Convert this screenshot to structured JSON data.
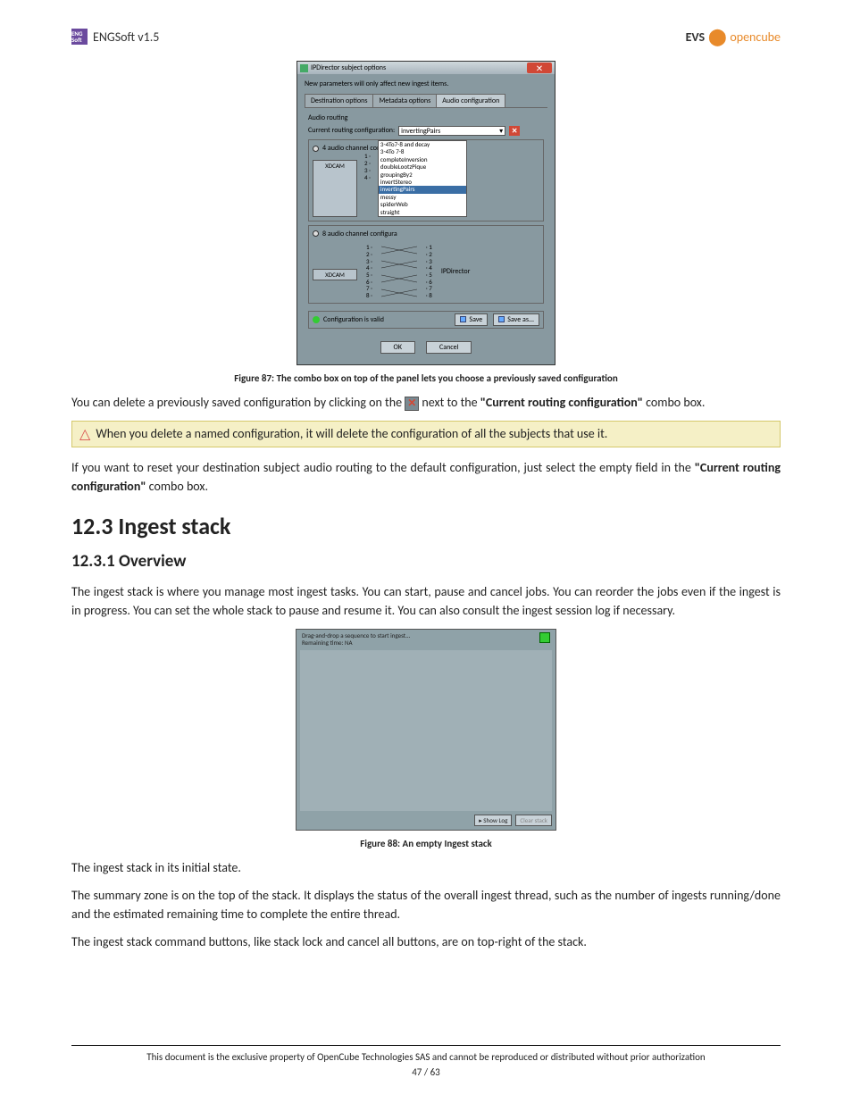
{
  "header": {
    "logo_text": "ENG Soft",
    "title": "ENGSoft v1.5",
    "right_brand1": "EVS",
    "right_brand2": "opencube"
  },
  "dialog87": {
    "title": "IPDirector subject options",
    "notice": "New parameters will only affect new ingest items.",
    "tabs": [
      "Destination options",
      "Metadata options",
      "Audio configuration"
    ],
    "panel_label": "Audio routing",
    "combo_label": "Current routing configuration:",
    "combo_value": "invertingPairs",
    "dropdown_items": [
      "3-4To7-8 and decay",
      "3-4To 7-8",
      "completeInversion",
      "doubleLootzPique",
      "groupingBy2",
      "invertStereo",
      "invertingPairs",
      "messy",
      "spiderWeb",
      "straight"
    ],
    "group4_label": "4 audio channel configura",
    "group8_label": "8 audio channel configura",
    "xdcam": "XDCAM",
    "ipdirector": "IPDirector",
    "valid_text": "Configuration is valid",
    "save": "Save",
    "save_as": "Save as...",
    "ok": "OK",
    "cancel": "Cancel"
  },
  "caption87": "Figure 87: The combo box on top of the panel lets you choose a previously saved configuration",
  "para1_a": "You can delete a previously saved configuration by clicking on the ",
  "para1_b": " next to the ",
  "para1_bold": "\"Current routing configuration\"",
  "para1_c": " combo box.",
  "warn_text": "When you delete a named configuration, it will delete the configuration of all the subjects that use it.",
  "para2_a": "If you want to reset your destination subject audio routing to the default configuration, just select the empty field in the ",
  "para2_bold": "\"Current routing configuration\"",
  "para2_b": " combo box.",
  "h1": "12.3 Ingest stack",
  "h2": "12.3.1 Overview",
  "para3": "The ingest stack is where you manage most ingest tasks. You can start, pause and cancel jobs. You can reorder the jobs even if the ingest is in progress. You can set the whole stack to pause and resume it. You can also consult the ingest session log if necessary.",
  "stack88": {
    "hint": "Drag-and-drop a sequence to start ingest...",
    "remaining": "Remaining time: NA",
    "show_log": "Show Log",
    "clear": "Clear stack"
  },
  "caption88": "Figure 88: An empty Ingest stack",
  "para4": "The ingest stack in its initial state.",
  "para5": "The summary zone is on the top of the stack. It displays the status of the overall ingest thread, such as the number of ingests running/done and the estimated remaining time to complete the entire thread.",
  "para6": "The ingest stack command buttons, like stack lock and cancel all buttons, are on top-right of the stack.",
  "footer": {
    "text": "This document is the exclusive property of OpenCube Technologies SAS and cannot be reproduced or distributed without prior authorization",
    "page": "47 / 63"
  }
}
